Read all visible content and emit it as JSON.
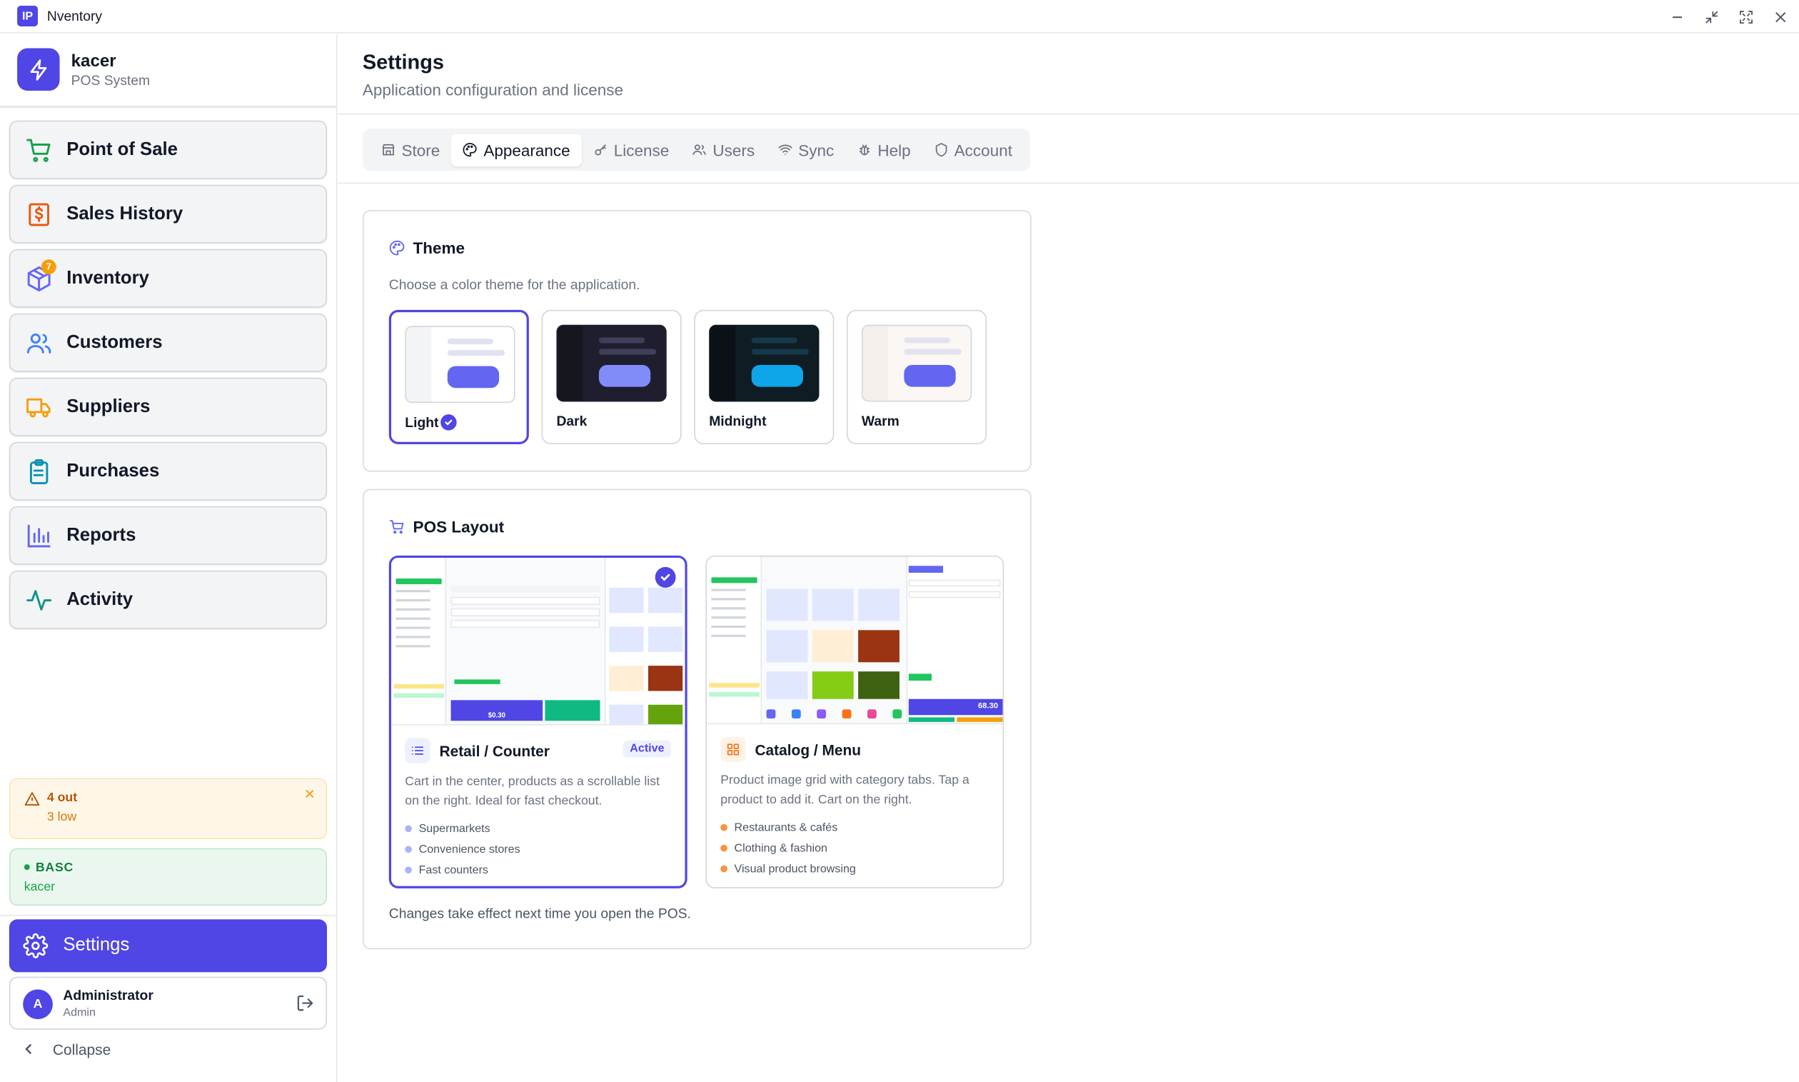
{
  "window": {
    "icon_text": "IP",
    "title": "Nventory"
  },
  "brand": {
    "name": "kacer",
    "subtitle": "POS System"
  },
  "nav": {
    "items": [
      {
        "label": "Point of Sale",
        "icon": "cart-icon"
      },
      {
        "label": "Sales History",
        "icon": "receipt-dollar-icon"
      },
      {
        "label": "Inventory",
        "icon": "box-icon",
        "badge": "7"
      },
      {
        "label": "Customers",
        "icon": "users-icon"
      },
      {
        "label": "Suppliers",
        "icon": "truck-icon"
      },
      {
        "label": "Purchases",
        "icon": "clipboard-icon"
      },
      {
        "label": "Reports",
        "icon": "bar-chart-icon"
      },
      {
        "label": "Activity",
        "icon": "activity-icon"
      }
    ]
  },
  "stock_alert": {
    "out": "4 out",
    "low": "3 low"
  },
  "plan": {
    "name": "BASC",
    "user": "kacer"
  },
  "settings_button": "Settings",
  "user": {
    "avatar": "A",
    "name": "Administrator",
    "role": "Admin"
  },
  "collapse_label": "Collapse",
  "page": {
    "title": "Settings",
    "subtitle": "Application configuration and license"
  },
  "tabs": [
    {
      "label": "Store",
      "active": false
    },
    {
      "label": "Appearance",
      "active": true
    },
    {
      "label": "License",
      "active": false
    },
    {
      "label": "Users",
      "active": false
    },
    {
      "label": "Sync",
      "active": false
    },
    {
      "label": "Help",
      "active": false
    },
    {
      "label": "Account",
      "active": false
    }
  ],
  "theme": {
    "title": "Theme",
    "description": "Choose a color theme for the application.",
    "options": [
      {
        "name": "Light",
        "selected": true,
        "bg": "#ffffff",
        "side": "#f3f4f6",
        "line": "#e0e2f0",
        "btn": "#6366f1"
      },
      {
        "name": "Dark",
        "selected": false,
        "bg": "#1e1e2e",
        "side": "#16161f",
        "line": "#3f3f5a",
        "btn": "#818cf8"
      },
      {
        "name": "Midnight",
        "selected": false,
        "bg": "#0f1c24",
        "side": "#0b1117",
        "line": "#16394a",
        "btn": "#0ea5e9"
      },
      {
        "name": "Warm",
        "selected": false,
        "bg": "#faf7f4",
        "side": "#f4efea",
        "line": "#e4e2ee",
        "btn": "#6366f1"
      }
    ]
  },
  "pos_layout": {
    "title": "POS Layout",
    "options": [
      {
        "title": "Retail / Counter",
        "active_badge": "Active",
        "selected": true,
        "description": "Cart in the center, products as a scrollable list on the right. Ideal for fast checkout.",
        "bullets": [
          "Supermarkets",
          "Convenience stores",
          "Fast counters"
        ],
        "bullet_color": "#a5b4fc",
        "preview_total": "$0.30"
      },
      {
        "title": "Catalog / Menu",
        "selected": false,
        "description": "Product image grid with category tabs. Tap a product to add it. Cart on the right.",
        "bullets": [
          "Restaurants & cafés",
          "Clothing & fashion",
          "Visual product browsing"
        ],
        "bullet_color": "#fb923c",
        "preview_total": "68.30"
      }
    ],
    "footer": "Changes take effect next time you open the POS."
  }
}
